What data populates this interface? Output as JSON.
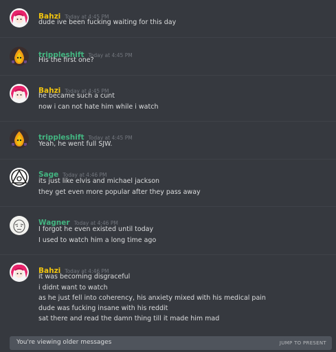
{
  "colors": {
    "background": "#36393f",
    "bahzi": "#f1c40f",
    "trippleshift": "#43b581",
    "sage": "#43b581",
    "wagner": "#43b581",
    "text": "#dcddde",
    "timestamp": "#72767d",
    "older_bar": "#4f545c"
  },
  "messages": [
    {
      "author": "Bahzi",
      "avatar_icon": "red-hair-avatar-icon",
      "timestamp": "Today at 4:45 PM",
      "lines": [
        "dude ive been fucking waiting for this day"
      ]
    },
    {
      "author": "trippleshift",
      "avatar_icon": "flame-character-avatar-icon",
      "timestamp": "Today at 4:45 PM",
      "lines": [
        "His the first one?"
      ]
    },
    {
      "author": "Bahzi",
      "avatar_icon": "red-hair-avatar-icon",
      "timestamp": "Today at 4:45 PM",
      "lines": [
        "he became such a cunt",
        "now i can not hate him while i watch"
      ]
    },
    {
      "author": "trippleshift",
      "avatar_icon": "flame-character-avatar-icon",
      "timestamp": "Today at 4:45 PM",
      "lines": [
        "Yeah, he went full SJW."
      ]
    },
    {
      "author": "Sage",
      "avatar_icon": "triangle-symbol-avatar-icon",
      "timestamp": "Today at 4:46 PM",
      "lines": [
        "its just like elvis and michael jackson",
        "they get even more popular after they pass away"
      ]
    },
    {
      "author": "Wagner",
      "avatar_icon": "sketch-face-avatar-icon",
      "timestamp": "Today at 4:46 PM",
      "lines": [
        "I forgot he even existed until today",
        "I used to watch him a long time ago"
      ]
    },
    {
      "author": "Bahzi",
      "avatar_icon": "red-hair-avatar-icon",
      "timestamp": "Today at 4:46 PM",
      "lines": [
        "it was becoming disgraceful",
        "i didnt want to watch",
        "as he just fell into coherency, his anxiety mixed with his medical pain",
        "dude was fucking insane with his reddit",
        "sat there and read the damn thing till it made him mad"
      ]
    }
  ],
  "older_bar": {
    "text": "You're viewing older messages",
    "jump_label": "JUMP TO PRESENT"
  }
}
